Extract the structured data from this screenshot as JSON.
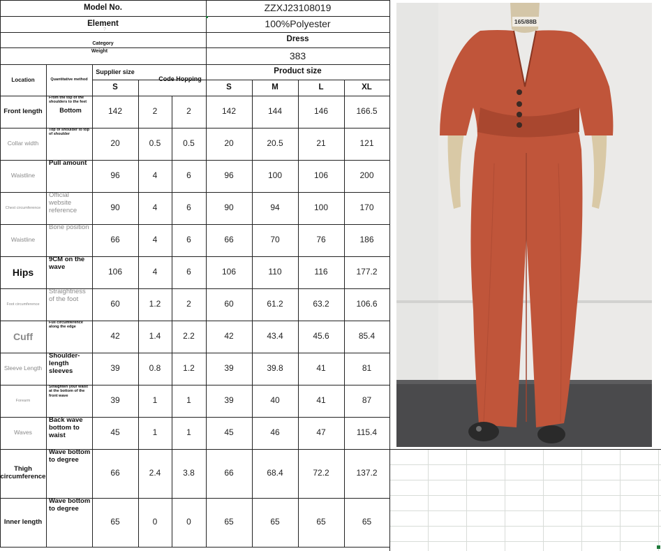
{
  "header": {
    "model_label": "Model No.",
    "model_value": "ZZXJ23108019",
    "element_label": "Element",
    "element_value": "100%Polyester",
    "element_sub": "?",
    "category_label": "Category",
    "category_value": "Dress",
    "weight_label": "Weight",
    "weight_value": "383"
  },
  "table": {
    "location_header": "Location",
    "method_header": "Quantitative method",
    "supplier_size_header": "Supplier size",
    "code_hopping_header": "Code Hopping",
    "product_size_header": "Product size",
    "supplier_sizes": [
      "S"
    ],
    "product_sizes": [
      "S",
      "M",
      "L",
      "XL"
    ],
    "rows": [
      {
        "location": "Front length",
        "method": "From the top of the shoulders to the feet",
        "method2": "Bottom",
        "supplier_s": "142",
        "hop1": "2",
        "hop2": "2",
        "s": "142",
        "m": "144",
        "l": "146",
        "xl": "166.5"
      },
      {
        "location": "Collar width",
        "method": "Top of shoulder to top of shoulder",
        "supplier_s": "20",
        "hop1": "0.5",
        "hop2": "0.5",
        "s": "20",
        "m": "20.5",
        "l": "21",
        "xl": "121"
      },
      {
        "location": "Waistline",
        "method": "Pull amount",
        "supplier_s": "96",
        "hop1": "4",
        "hop2": "6",
        "s": "96",
        "m": "100",
        "l": "106",
        "xl": "200"
      },
      {
        "location": "Chest circumference",
        "method": "Official website reference",
        "supplier_s": "90",
        "hop1": "4",
        "hop2": "6",
        "s": "90",
        "m": "94",
        "l": "100",
        "xl": "170"
      },
      {
        "location": "Waistline",
        "method": "Bone position",
        "supplier_s": "66",
        "hop1": "4",
        "hop2": "6",
        "s": "66",
        "m": "70",
        "l": "76",
        "xl": "186"
      },
      {
        "location": "Hips",
        "method": "9CM on the wave",
        "supplier_s": "106",
        "hop1": "4",
        "hop2": "6",
        "s": "106",
        "m": "110",
        "l": "116",
        "xl": "177.2"
      },
      {
        "location": "Foot circumference",
        "method": "Straightness of the foot",
        "supplier_s": "60",
        "hop1": "1.2",
        "hop2": "2",
        "s": "60",
        "m": "61.2",
        "l": "63.2",
        "xl": "106.6"
      },
      {
        "location": "Cuff",
        "method": "Full circumference along the edge",
        "supplier_s": "42",
        "hop1": "1.4",
        "hop2": "2.2",
        "s": "42",
        "m": "43.4",
        "l": "45.6",
        "xl": "85.4"
      },
      {
        "location": "Sleeve Length",
        "method": "Shoulder-length sleeves",
        "supplier_s": "39",
        "hop1": "0.8",
        "hop2": "1.2",
        "s": "39",
        "m": "39.8",
        "l": "41",
        "xl": "81"
      },
      {
        "location": "Forearm",
        "method": "Straighten your waist at the bottom of the front wave",
        "supplier_s": "39",
        "hop1": "1",
        "hop2": "1",
        "s": "39",
        "m": "40",
        "l": "41",
        "xl": "87"
      },
      {
        "location": "Waves",
        "method": "Back wave bottom to waist",
        "supplier_s": "45",
        "hop1": "1",
        "hop2": "1",
        "s": "45",
        "m": "46",
        "l": "47",
        "xl": "115.4"
      },
      {
        "location": "Thigh circumference",
        "method": "Wave bottom to degree",
        "supplier_s": "66",
        "hop1": "2.4",
        "hop2": "3.8",
        "s": "66",
        "m": "68.4",
        "l": "72.2",
        "xl": "137.2"
      },
      {
        "location": "Inner length",
        "method": "Wave bottom to degree",
        "supplier_s": "65",
        "hop1": "0",
        "hop2": "0",
        "s": "65",
        "m": "65",
        "l": "65",
        "xl": "65"
      }
    ]
  },
  "photo": {
    "tag_text": "165/88B",
    "garment_color": "#c0553a",
    "wall_color": "#ebeae8",
    "floor_color": "#4a4a4c"
  }
}
